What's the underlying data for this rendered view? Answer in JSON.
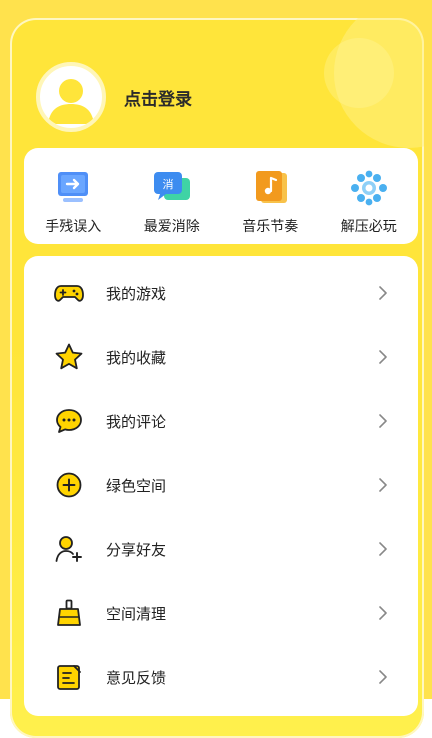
{
  "header": {
    "login_text": "点击登录"
  },
  "quick_actions": [
    {
      "label": "手残误入",
      "icon": "monitor-arrow-icon",
      "color": "#4f8ff7"
    },
    {
      "label": "最爱消除",
      "icon": "chat-bubbles-icon",
      "color": "#3d8cf0"
    },
    {
      "label": "音乐节奏",
      "icon": "music-note-icon",
      "color": "#f29a1e"
    },
    {
      "label": "解压必玩",
      "icon": "gear-dots-icon",
      "color": "#4ab0f0"
    }
  ],
  "menu": [
    {
      "label": "我的游戏",
      "icon": "gamepad-icon"
    },
    {
      "label": "我的收藏",
      "icon": "star-icon"
    },
    {
      "label": "我的评论",
      "icon": "comment-icon"
    },
    {
      "label": "绿色空间",
      "icon": "plus-circle-icon"
    },
    {
      "label": "分享好友",
      "icon": "add-friend-icon"
    },
    {
      "label": "空间清理",
      "icon": "broom-icon"
    },
    {
      "label": "意见反馈",
      "icon": "feedback-edit-icon"
    }
  ],
  "colors": {
    "accent_yellow": "#ffe53a",
    "icon_yellow": "#ffd400"
  }
}
